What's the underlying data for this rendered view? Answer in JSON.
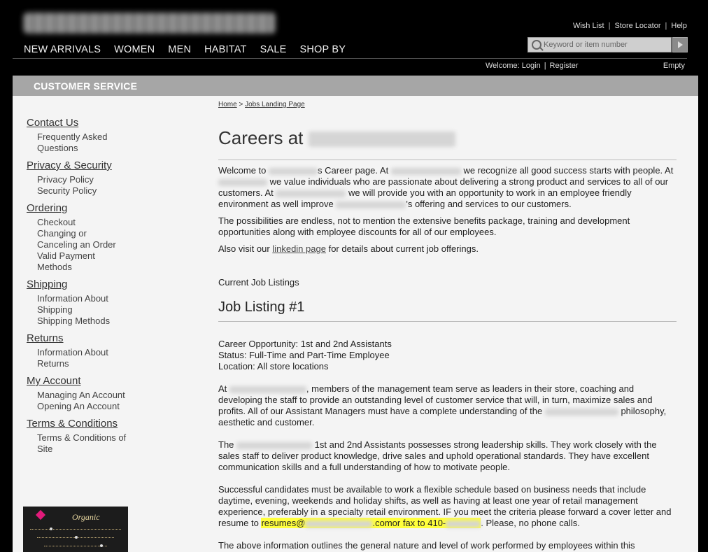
{
  "header": {
    "util_links": [
      "Wish List",
      "Store Locator",
      "Help"
    ],
    "nav": [
      "NEW ARRIVALS",
      "WOMEN",
      "MEN",
      "HABITAT",
      "SALE",
      "SHOP BY"
    ],
    "search_placeholder": "Keyword or item number",
    "welcome_text": "Welcome:",
    "login_label": "Login",
    "register_label": "Register",
    "cart_status": "Empty"
  },
  "section_bar": {
    "title": "CUSTOMER SERVICE"
  },
  "sidebar": [
    {
      "title": "Contact Us",
      "items": [
        "Frequently Asked",
        "Questions"
      ]
    },
    {
      "title": "Privacy & Security",
      "items": [
        "Privacy Policy",
        "Security Policy"
      ]
    },
    {
      "title": "Ordering",
      "items": [
        "Checkout",
        "Changing or",
        "Canceling an Order",
        "Valid Payment",
        "Methods"
      ]
    },
    {
      "title": "Shipping",
      "items": [
        "Information About",
        "Shipping",
        "Shipping Methods"
      ]
    },
    {
      "title": "Returns",
      "items": [
        "Information About",
        "Returns"
      ]
    },
    {
      "title": "My Account",
      "items": [
        "Managing An Account",
        "Opening An Account"
      ]
    },
    {
      "title": "Terms & Conditions",
      "items": [
        "Terms & Conditions of",
        "Site"
      ]
    }
  ],
  "ad": {
    "brand_text": "Organic"
  },
  "breadcrumb": {
    "home": "Home",
    "sep": ">",
    "current": "Jobs Landing Page"
  },
  "page": {
    "title_prefix": "Careers at",
    "intro": {
      "a": "Welcome to",
      "b": "s Career page. At",
      "c": "we recognize all good success starts with people. At",
      "d": "we value individuals who are passionate about delivering a strong product and services to all of our customers. At",
      "e": "we will provide you with an opportunity to work in an employee friendly environment as well improve",
      "f": "'s offering and services to our customers."
    },
    "possibilities": "The possibilities are endless, not to mention the extensive benefits package, training and development opportunities along with employee discounts for all of our employees.",
    "visit_prefix": "Also visit our",
    "linkedin_link": "linkedin page",
    "visit_suffix": "for details about current job offerings.",
    "listings_label": "Current Job Listings",
    "job_heading": "Job Listing #1",
    "job_details": [
      "Career Opportunity: 1st and 2nd Assistants",
      "Status: Full-Time and Part-Time Employee",
      "Location: All store locations"
    ],
    "para1": {
      "a": "At",
      "b": ", members of the management team serve as leaders in their store, coaching and developing the staff to provide an outstanding level of customer service that will, in turn, maximize sales and profits. All of our Assistant Managers must have a complete understanding of the",
      "c": "philosophy, aesthetic and customer."
    },
    "para2": {
      "a": "The",
      "b": "1st and 2nd Assistants possesses strong leadership skills. They work closely with the sales staff to deliver product knowledge, drive sales and uphold operational standards. They have excellent communication skills and a full understanding of how to motivate people."
    },
    "para3": {
      "a": "Successful candidates must be available to work a flexible schedule based on business needs that include daytime, evening, weekends and holiday shifts, as well as having at least one year of retail management experience, preferably in a specialty retail environment. IF you meet the criteria please forward a cover letter and resume to",
      "email_prefix": "resumes@",
      "email_suffix": ".comor fax to 410-",
      "c": ". Please, no phone calls."
    },
    "para4": "The above information outlines the general nature and level of work performed by employees within this"
  }
}
